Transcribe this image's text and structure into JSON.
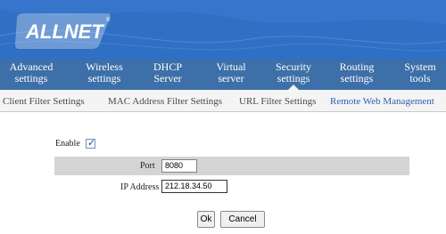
{
  "brand": {
    "logo_text": "ALLNET",
    "registered_mark": "®"
  },
  "nav": {
    "items": [
      {
        "line1": "Advanced",
        "line2": "settings"
      },
      {
        "line1": "Wireless",
        "line2": "settings"
      },
      {
        "line1": "DHCP",
        "line2": "Server"
      },
      {
        "line1": "Virtual",
        "line2": "server"
      },
      {
        "line1": "Security",
        "line2": "settings"
      },
      {
        "line1": "Routing",
        "line2": "settings"
      },
      {
        "line1": "System",
        "line2": "tools"
      }
    ],
    "active_index": 4
  },
  "subnav": {
    "items": [
      "Client Filter Settings",
      "MAC Address Filter Settings",
      "URL Filter Settings",
      "Remote Web Management"
    ],
    "active_index": 3
  },
  "form": {
    "enable_label": "Enable",
    "enable_checked": true,
    "port_label": "Port",
    "port_value": "8080",
    "ip_label": "IP Address",
    "ip_value": "212.18.34.50"
  },
  "buttons": {
    "ok": "Ok",
    "cancel": "Cancel"
  },
  "colors": {
    "header_blue": "#2f6fc4",
    "nav_blue": "#3d6fa8",
    "active_link": "#2c5fb0"
  }
}
